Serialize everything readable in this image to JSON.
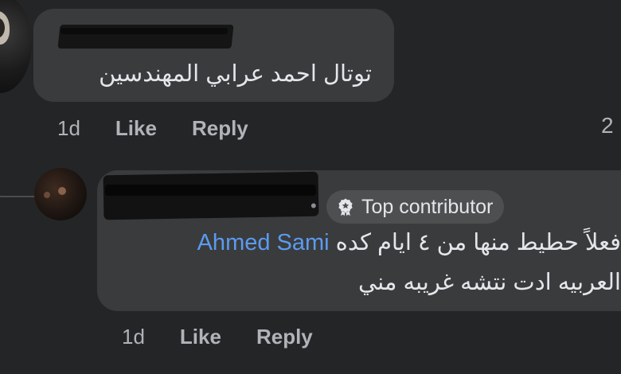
{
  "comments": [
    {
      "author_redacted": true,
      "text": "توتال احمد عرابي المهندسين",
      "time": "1d",
      "like_label": "Like",
      "reply_label": "Reply",
      "reaction_count": "2"
    }
  ],
  "reply": {
    "author_redacted": true,
    "badge_label": "Top contributor",
    "badge_icon": "award-icon",
    "mention": "Ahmed Sami",
    "line1_text": "فعلاً حطيط منها من ٤ ايام كده",
    "line2_text": "العربيه ادت نتشه غريبه مني",
    "time": "1d",
    "like_label": "Like",
    "reply_label": "Reply"
  },
  "theme": {
    "background": "#242526",
    "bubble": "#3a3b3c",
    "text": "#e4e6eb",
    "secondary_text": "#b0b3b8",
    "mention_color": "#5b9bf0",
    "badge_bg": "#4e4f50"
  }
}
